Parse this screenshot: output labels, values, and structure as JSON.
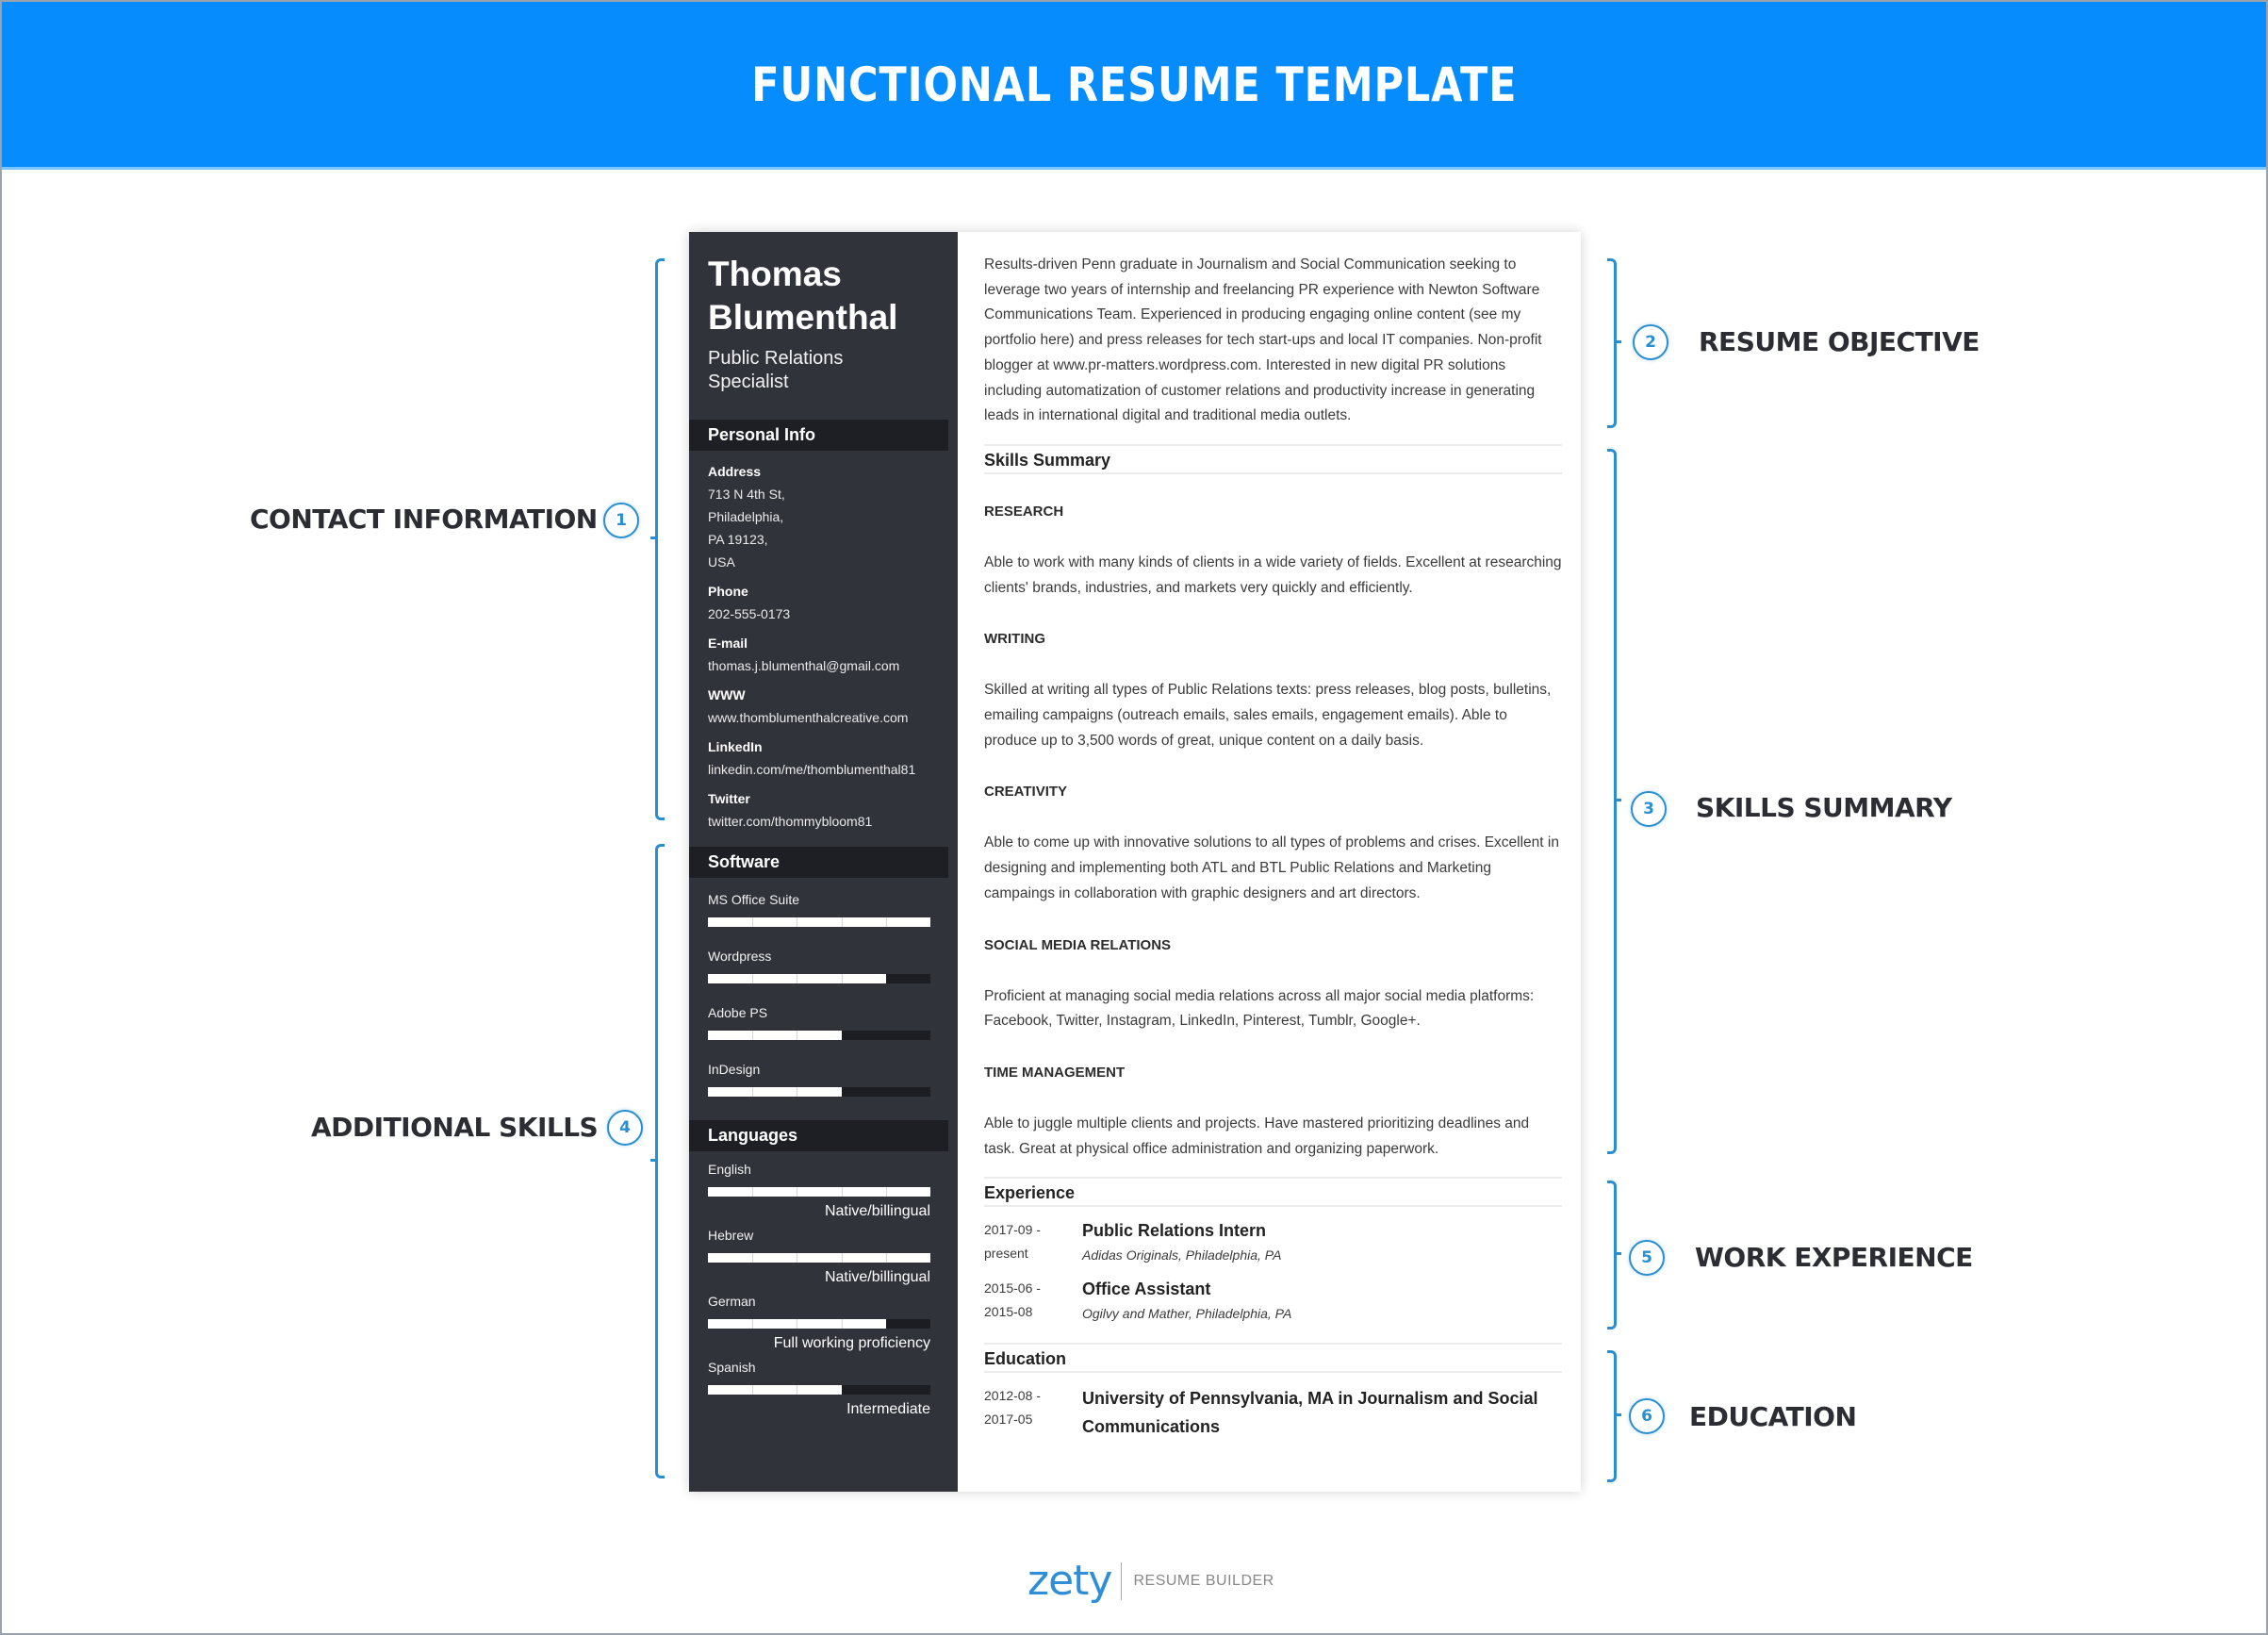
{
  "banner": {
    "title": "FUNCTIONAL RESUME TEMPLATE",
    "color": "#068cfc"
  },
  "annotations": [
    {
      "num": "1",
      "label": "CONTACT INFORMATION"
    },
    {
      "num": "2",
      "label": "RESUME OBJECTIVE"
    },
    {
      "num": "3",
      "label": "SKILLS SUMMARY"
    },
    {
      "num": "4",
      "label": "ADDITIONAL SKILLS"
    },
    {
      "num": "5",
      "label": "WORK EXPERIENCE"
    },
    {
      "num": "6",
      "label": "EDUCATION"
    }
  ],
  "resume": {
    "name_line1": "Thomas",
    "name_line2": "Blumenthal",
    "role_line1": "Public Relations",
    "role_line2": "Specialist",
    "personal_info": {
      "heading": "Personal Info",
      "address_label": "Address",
      "address_lines": [
        "713 N 4th St,",
        "Philadelphia,",
        "PA 19123,",
        "USA"
      ],
      "phone_label": "Phone",
      "phone": "202-555-0173",
      "email_label": "E-mail",
      "email": "thomas.j.blumenthal@gmail.com",
      "www_label": "WWW",
      "www": "www.thomblumenthalcreative.com",
      "linkedin_label": "LinkedIn",
      "linkedin": "linkedin.com/me/thomblumenthal81",
      "twitter_label": "Twitter",
      "twitter": "twitter.com/thommybloom81"
    },
    "software": {
      "heading": "Software",
      "items": [
        {
          "name": "MS Office Suite",
          "level": 1.0
        },
        {
          "name": "Wordpress",
          "level": 0.8
        },
        {
          "name": "Adobe PS",
          "level": 0.6
        },
        {
          "name": "InDesign",
          "level": 0.6
        }
      ]
    },
    "languages": {
      "heading": "Languages",
      "items": [
        {
          "name": "English",
          "level": 1.0,
          "proficiency": "Native/billingual"
        },
        {
          "name": "Hebrew",
          "level": 1.0,
          "proficiency": "Native/billingual"
        },
        {
          "name": "German",
          "level": 0.8,
          "proficiency": "Full working proficiency"
        },
        {
          "name": "Spanish",
          "level": 0.6,
          "proficiency": "Intermediate"
        }
      ]
    },
    "objective": "Results-driven Penn graduate in Journalism and Social Communication seeking to leverage two years of internship and freelancing PR experience with Newton Software Communications Team. Experienced in producing engaging online content (see my portfolio here) and press releases for tech start-ups and local IT companies. Non-profit blogger at www.pr-matters.wordpress.com. Interested in new digital PR solutions including automatization of customer relations and productivity increase in generating leads in international digital and traditional media outlets.",
    "skills_summary": {
      "heading": "Skills Summary",
      "items": [
        {
          "title": "RESEARCH",
          "desc": "Able to work with many kinds of clients in a wide variety of fields. Excellent at researching clients' brands, industries, and markets very quickly and efficiently."
        },
        {
          "title": "WRITING",
          "desc": "Skilled at writing all types of Public Relations texts: press releases, blog posts, bulletins, emailing campaigns (outreach emails, sales emails, engagement emails). Able to produce up to 3,500 words of great, unique content on a daily basis."
        },
        {
          "title": "CREATIVITY",
          "desc": "Able to come up with innovative solutions to all types of problems and crises. Excellent in designing and implementing both ATL and BTL Public Relations and Marketing campaings in collaboration with graphic designers and art directors."
        },
        {
          "title": "SOCIAL MEDIA RELATIONS",
          "desc": "Proficient at managing social media relations across all major social media platforms: Facebook, Twitter, Instagram, LinkedIn, Pinterest, Tumblr, Google+."
        },
        {
          "title": "TIME MANAGEMENT",
          "desc": "Able to juggle multiple clients and projects. Have mastered prioritizing deadlines and task. Great at physical office administration and organizing paperwork."
        }
      ]
    },
    "experience": {
      "heading": "Experience",
      "items": [
        {
          "date1": "2017-09 -",
          "date2": "present",
          "title": "Public Relations Intern",
          "org": "Adidas Originals, Philadelphia, PA"
        },
        {
          "date1": "2015-06 -",
          "date2": "2015-08",
          "title": "Office Assistant",
          "org": "Ogilvy and Mather, Philadelphia, PA"
        }
      ]
    },
    "education": {
      "heading": "Education",
      "items": [
        {
          "date1": "2012-08 -",
          "date2": "2017-05",
          "title": "University of Pennsylvania, MA in Journalism and Social Communications"
        }
      ]
    }
  },
  "footer": {
    "brand": "zety",
    "tagline": "RESUME BUILDER"
  }
}
